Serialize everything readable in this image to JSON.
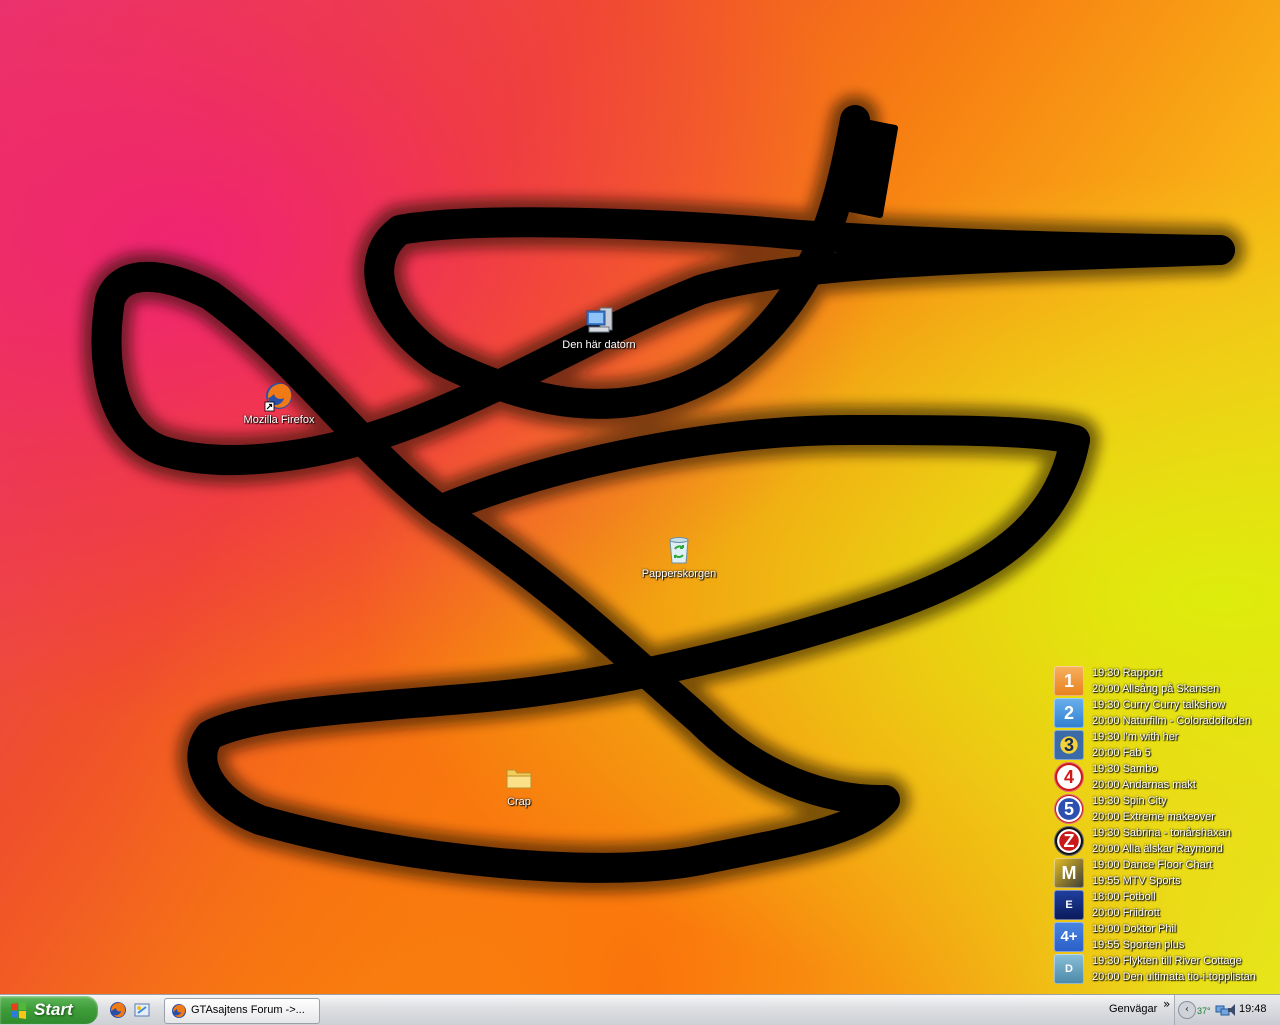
{
  "desktop": {
    "icons": [
      {
        "label": "Mozilla Firefox"
      },
      {
        "label": "Den här datorn"
      },
      {
        "label": "Papperskorgen"
      },
      {
        "label": "Crap"
      }
    ]
  },
  "tv_widget": {
    "channels": [
      {
        "logo_text": "1",
        "color": "#f0922c",
        "lines": [
          "19:30 Rapport",
          "20:00 Allsång på Skansen"
        ]
      },
      {
        "logo_text": "2",
        "color": "#2f7fd0",
        "lines": [
          "19:30 Curry Curry talkshow",
          "20:00 Naturfilm - Coloradofloden"
        ]
      },
      {
        "logo_text": "3",
        "color": "#3a6aa8",
        "lines": [
          "19:30 I'm with her",
          "20:00 Fab 5"
        ]
      },
      {
        "logo_text": "4",
        "color": "#d01818",
        "lines": [
          "19:30 Sambo",
          "20:00 Andarnas makt"
        ]
      },
      {
        "logo_text": "5",
        "color": "#c81a1a",
        "lines": [
          "19:30 Spin City",
          "20:00 Extreme makeover"
        ]
      },
      {
        "logo_text": "Z",
        "color": "#111111",
        "lines": [
          "19:30 Sabrina - tonårshäxan",
          "20:00 Alla älskar Raymond"
        ]
      },
      {
        "logo_text": "M",
        "color": "#1a1a1a",
        "lines": [
          "19:00 Dance Floor Chart",
          "19:55 MTV Sports"
        ]
      },
      {
        "logo_text": "E",
        "color": "#0a1a5a",
        "lines": [
          "18:00 Fotboll",
          "20:00 Friidrott"
        ]
      },
      {
        "logo_text": "4+",
        "color": "#2a5ec8",
        "lines": [
          "19:00 Doktor Phil",
          "19:55 Sporten plus"
        ]
      },
      {
        "logo_text": "D",
        "color": "#4a88a8",
        "lines": [
          "19:30 Flykten till River Cottage",
          "20:00 Den ultimata tio-i-topplistan"
        ]
      }
    ]
  },
  "taskbar": {
    "start_label": "Start",
    "task_button_label": "GTAsajtens Forum ->...",
    "toolbar_label": "Genvägar",
    "chevron": "»",
    "tray_temp": "37°",
    "clock": "19:48"
  },
  "colors": {
    "taskbar_bg": "#dfe0e3",
    "start_green": "#3f9e3a"
  }
}
